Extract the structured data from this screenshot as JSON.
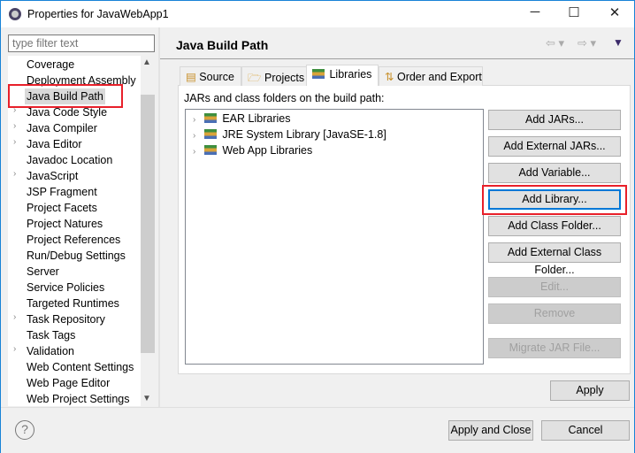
{
  "window": {
    "title": "Properties for JavaWebApp1",
    "minimize": "─",
    "maximize": "☐",
    "close": "✕"
  },
  "sidebar": {
    "filter_placeholder": "type filter text",
    "items": [
      {
        "label": "Coverage",
        "expandable": false
      },
      {
        "label": "Deployment Assembly",
        "expandable": false
      },
      {
        "label": "Java Build Path",
        "expandable": false,
        "selected": true
      },
      {
        "label": "Java Code Style",
        "expandable": true
      },
      {
        "label": "Java Compiler",
        "expandable": true
      },
      {
        "label": "Java Editor",
        "expandable": true
      },
      {
        "label": "Javadoc Location",
        "expandable": false
      },
      {
        "label": "JavaScript",
        "expandable": true
      },
      {
        "label": "JSP Fragment",
        "expandable": false
      },
      {
        "label": "Project Facets",
        "expandable": false
      },
      {
        "label": "Project Natures",
        "expandable": false
      },
      {
        "label": "Project References",
        "expandable": false
      },
      {
        "label": "Run/Debug Settings",
        "expandable": false
      },
      {
        "label": "Server",
        "expandable": false
      },
      {
        "label": "Service Policies",
        "expandable": false
      },
      {
        "label": "Targeted Runtimes",
        "expandable": false
      },
      {
        "label": "Task Repository",
        "expandable": true
      },
      {
        "label": "Task Tags",
        "expandable": false
      },
      {
        "label": "Validation",
        "expandable": true
      },
      {
        "label": "Web Content Settings",
        "expandable": false
      },
      {
        "label": "Web Page Editor",
        "expandable": false
      },
      {
        "label": "Web Project Settings",
        "expandable": false
      }
    ]
  },
  "page": {
    "title": "Java Build Path",
    "tabs": [
      {
        "label": "Source"
      },
      {
        "label": "Projects"
      },
      {
        "label": "Libraries",
        "selected": true
      },
      {
        "label": "Order and Export"
      }
    ],
    "list_label": "JARs and class folders on the build path:",
    "libraries": [
      "EAR Libraries",
      "JRE System Library [JavaSE-1.8]",
      "Web App Libraries"
    ],
    "buttons": [
      {
        "label": "Add JARs...",
        "enabled": true
      },
      {
        "label": "Add External JARs...",
        "enabled": true
      },
      {
        "label": "Add Variable...",
        "enabled": true
      },
      {
        "label": "Add Library...",
        "enabled": true,
        "highlighted": true
      },
      {
        "label": "Add Class Folder...",
        "enabled": true
      },
      {
        "label": "Add External Class Folder...",
        "enabled": true
      },
      {
        "label": "Edit...",
        "enabled": false
      },
      {
        "label": "Remove",
        "enabled": false
      },
      {
        "label": "Migrate JAR File...",
        "enabled": false
      }
    ],
    "apply": "Apply"
  },
  "footer": {
    "help": "?",
    "apply_close": "Apply and Close",
    "cancel": "Cancel"
  },
  "colors": {
    "highlight": "#e8202a",
    "focus": "#0078d7"
  }
}
